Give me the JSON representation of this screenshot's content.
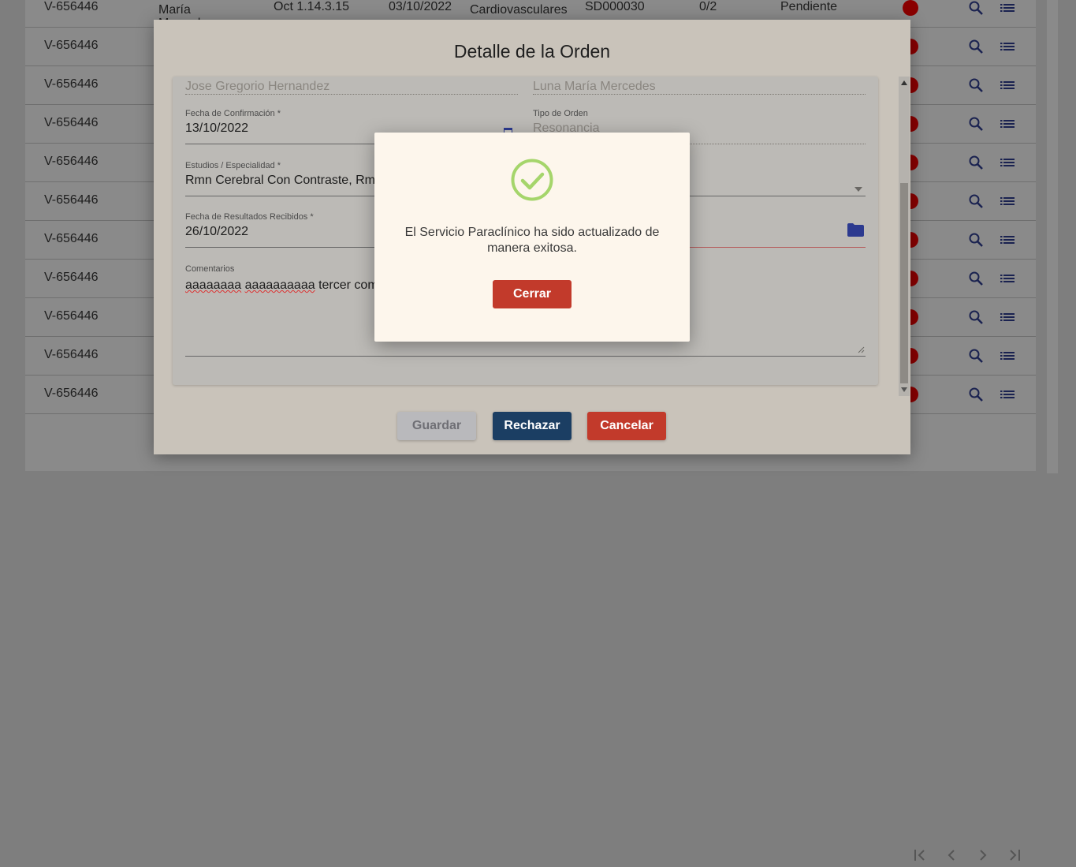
{
  "background": {
    "rows": [
      {
        "id": "V-656446",
        "patient": "Luna María Mercedes",
        "version": "Oct 1.14.3.15",
        "date": "03/10/2022",
        "study": "Pruebas Cardiovasculares",
        "code": "SD000030",
        "progress": "0/2",
        "status": "Pendiente"
      },
      {
        "id": "V-656446"
      },
      {
        "id": "V-656446"
      },
      {
        "id": "V-656446"
      },
      {
        "id": "V-656446"
      },
      {
        "id": "V-656446"
      },
      {
        "id": "V-656446"
      },
      {
        "id": "V-656446"
      },
      {
        "id": "V-656446"
      },
      {
        "id": "V-656446"
      },
      {
        "id": "V-656446"
      }
    ],
    "status_dot_color": "#8a0000"
  },
  "dialog": {
    "title": "Detalle de la Orden",
    "fields": {
      "doctor": "Jose Gregorio Hernandez",
      "patient": "Luna María Mercedes",
      "confirm_date_label": "Fecha de Confirmación *",
      "confirm_date": "13/10/2022",
      "order_type_label": "Tipo de Orden",
      "order_type": "Resonancia",
      "studies_label": "Estudios / Especialidad *",
      "studies": "Rmn Cerebral Con Contraste, Rmn",
      "results_date_label": "Fecha de Resultados Recibidos *",
      "results_date": "26/10/2022",
      "comments_label": "Comentarios",
      "comments_word1": "aaaaaaaa",
      "comments_word2": "aaaaaaaaaa",
      "comments_rest": " tercer com"
    },
    "buttons": {
      "save": "Guardar",
      "reject": "Rechazar",
      "cancel": "Cancelar"
    }
  },
  "modal": {
    "icon": "check-circle-icon",
    "message": "El Servicio Paraclínico ha sido actualizado de manera exitosa.",
    "close": "Cerrar",
    "accent": "#8bc34a"
  }
}
